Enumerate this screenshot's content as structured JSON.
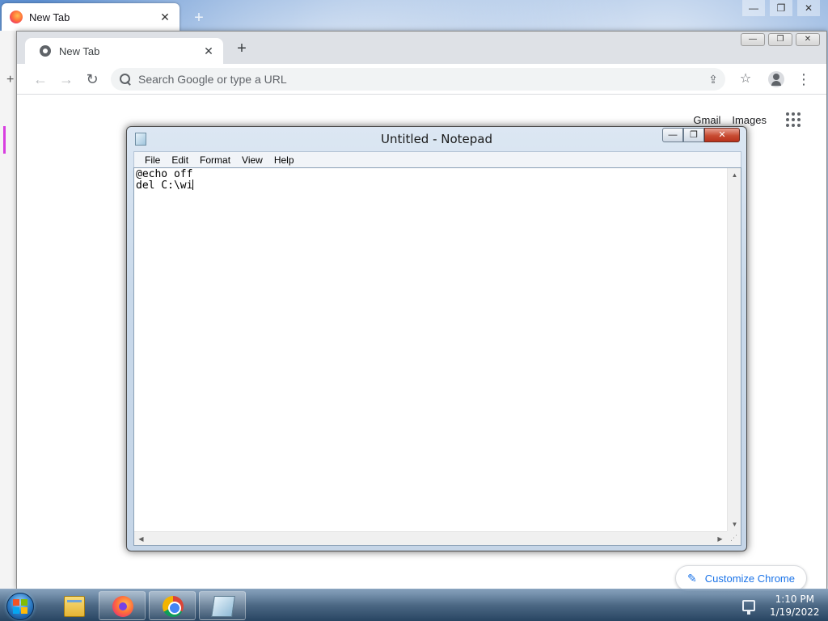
{
  "firefox": {
    "tab_title": "New Tab",
    "tab_close": "✕",
    "new_tab": "+",
    "controls": {
      "minimize": "—",
      "maximize": "❐",
      "close": "✕"
    }
  },
  "chrome": {
    "tab_title": "New Tab",
    "tab_close": "✕",
    "new_tab": "+",
    "controls": {
      "minimize": "—",
      "maximize": "❐",
      "close": "✕"
    },
    "nav": {
      "back": "←",
      "forward": "→",
      "reload": "↻"
    },
    "omnibox_placeholder": "Search Google or type a URL",
    "toolbar": {
      "share": "⇪",
      "star": "☆",
      "menu": "⋮"
    },
    "links": {
      "gmail": "Gmail",
      "images": "Images"
    },
    "customize_label": "Customize Chrome",
    "customize_icon": "✎"
  },
  "notepad": {
    "title": "Untitled - Notepad",
    "controls": {
      "minimize": "—",
      "maximize": "❐",
      "close": "✕"
    },
    "menu": [
      "File",
      "Edit",
      "Format",
      "View",
      "Help"
    ],
    "text_line1": "@echo off",
    "text_line2": "del C:\\wi",
    "scroll": {
      "up": "▲",
      "down": "▼",
      "left": "◀",
      "right": "▶",
      "grip": "⋰"
    }
  },
  "taskbar": {
    "apps": [
      "windows-explorer",
      "firefox",
      "chrome",
      "notepad"
    ],
    "clock_time": "1:10 PM",
    "clock_date": "1/19/2022"
  }
}
